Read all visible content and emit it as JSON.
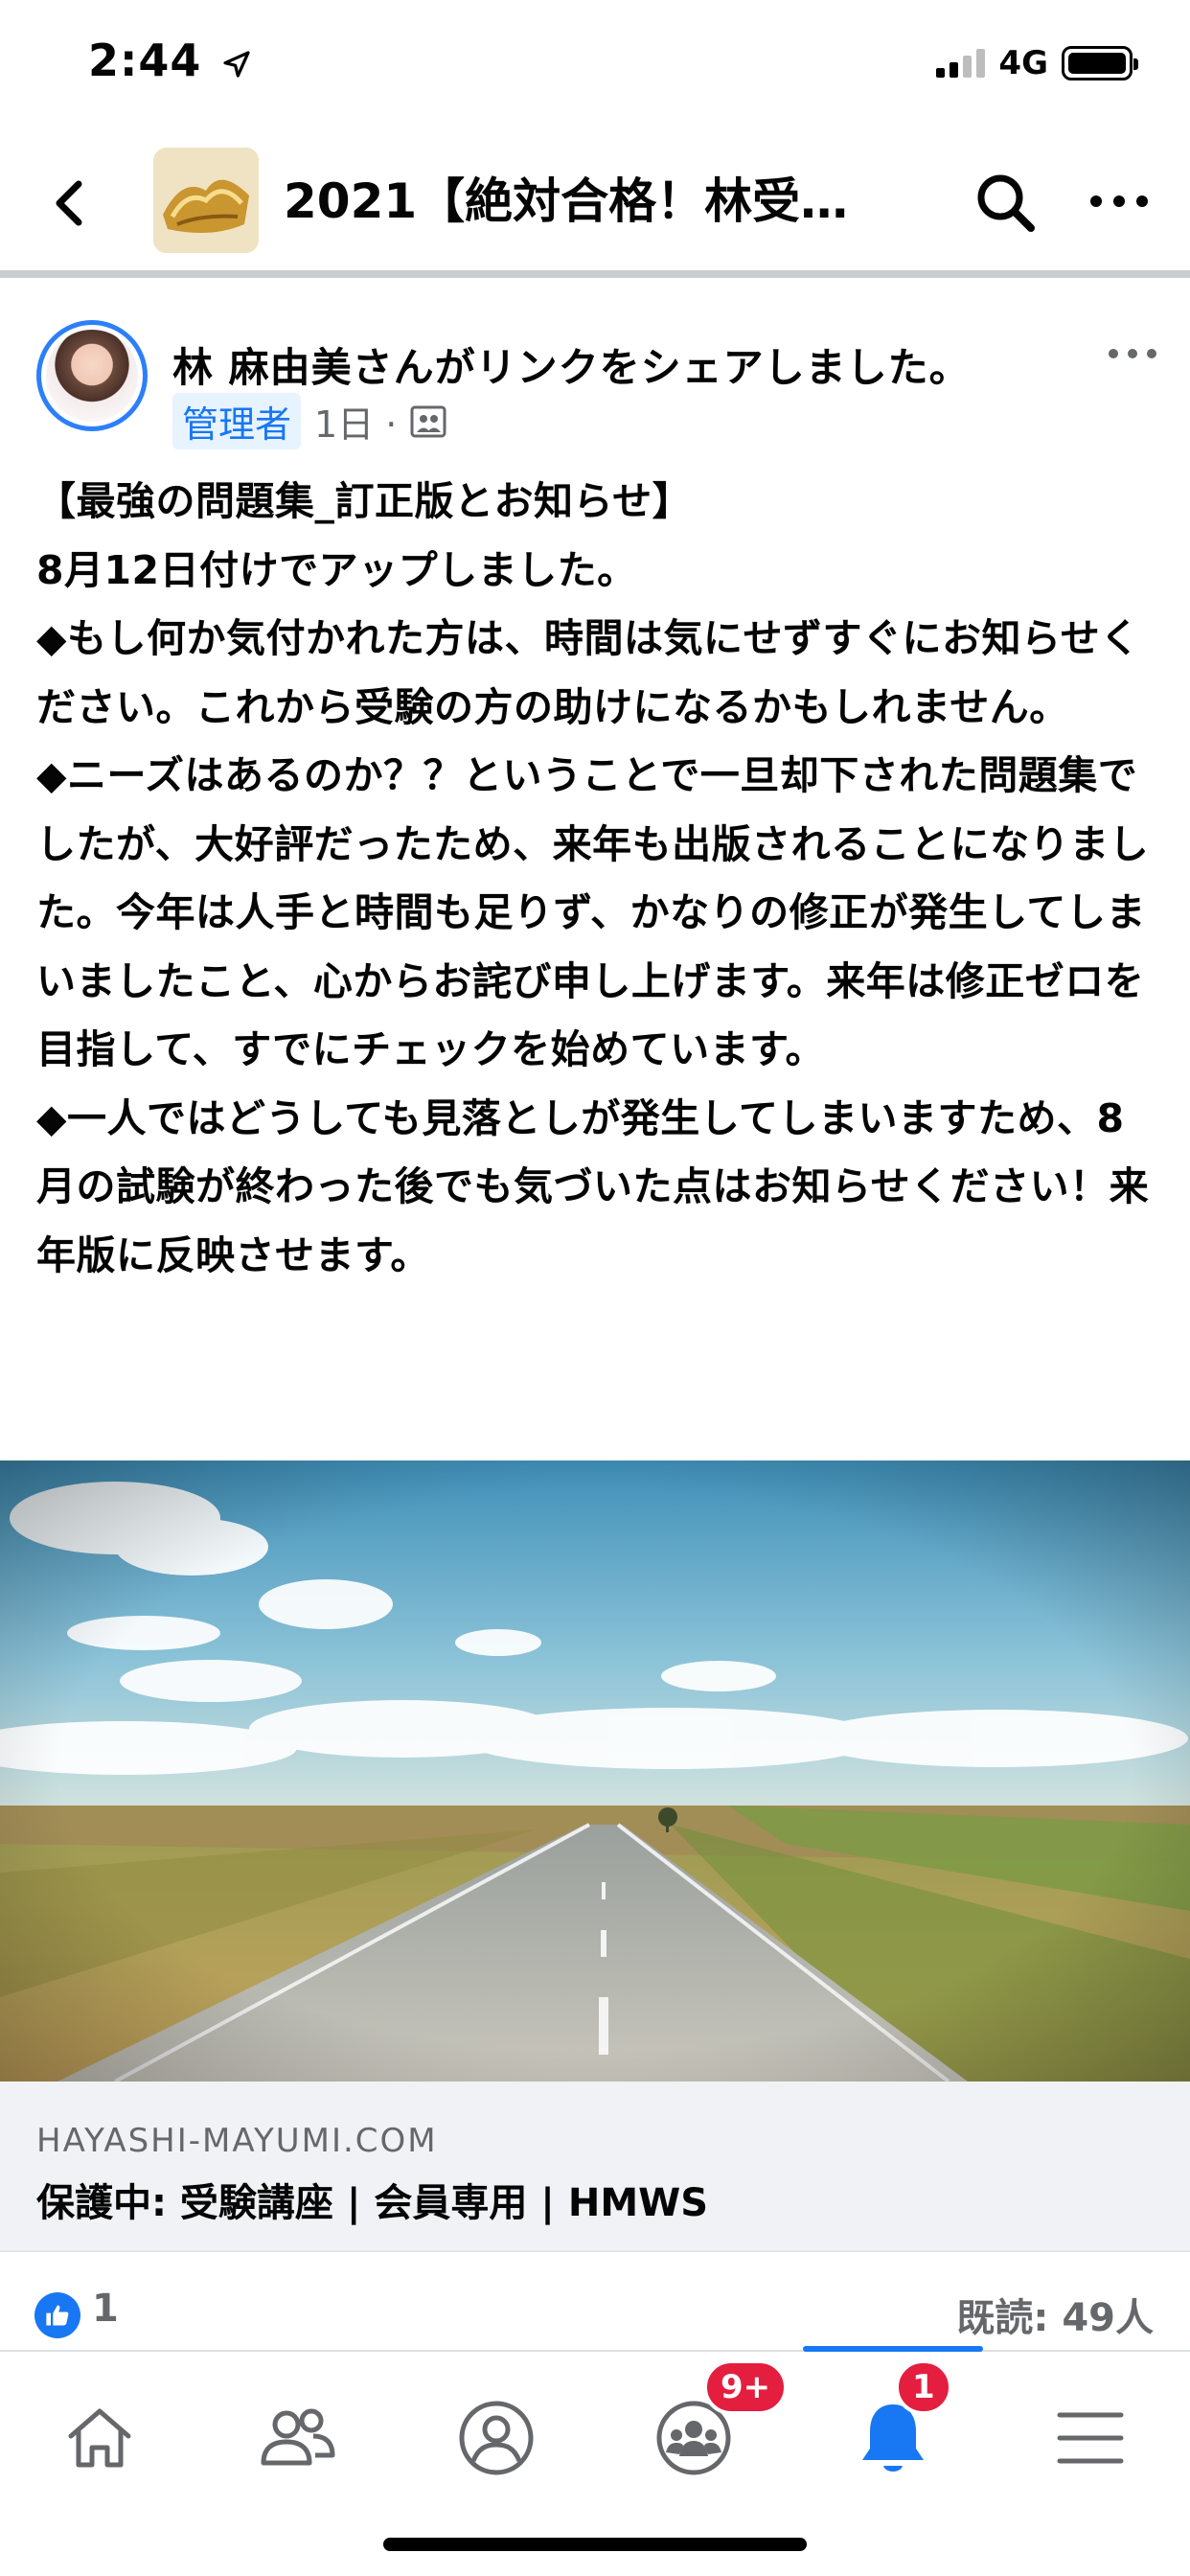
{
  "status_bar": {
    "time": "2:44",
    "network": "4G",
    "icons": [
      "location-arrow-icon",
      "signal-icon",
      "battery-icon"
    ]
  },
  "header": {
    "title": "2021【絶対合格！林受験…",
    "icons": [
      "back-icon",
      "search-icon",
      "more-icon"
    ]
  },
  "post": {
    "author_line": "林 麻由美さんがリンクをシェアしました。",
    "role_badge": "管理者",
    "time": "1日 ·",
    "privacy_icon": "group-icon",
    "paragraphs": [
      "【最強の問題集_訂正版とお知らせ】",
      "8月12日付けでアップしました。",
      "◆もし何か気付かれた方は、時間は気にせずすぐにお知らせください。これから受験の方の助けになるかもしれません。",
      "◆ニーズはあるのか？？ということで一旦却下された問題集でしたが、大好評だったため、来年も出版されることになりました。今年は人手と時間も足りず、かなりの修正が発生してしまいましたこと、心からお詫び申し上げます。来年は修正ゼロを目指して、すでにチェックを始めています。",
      "◆一人ではどうしても見落としが発生してしまいますため、8月の試験が終わった後でも気づいた点はお知らせください！来年版に反映させます。"
    ]
  },
  "link_preview": {
    "domain": "HAYASHI-MAYUMI.COM",
    "title": "保護中: 受験講座 | 会員専用 | HMWS"
  },
  "reactions": {
    "like_count": "1",
    "seen": "既読: 49人"
  },
  "bottom_nav": {
    "items": [
      "home-icon",
      "friends-icon",
      "profile-icon",
      "groups-icon",
      "notifications-icon",
      "menu-icon"
    ],
    "groups_badge": "9+",
    "notifications_badge": "1",
    "active": "notifications",
    "accent": "#1877f2",
    "badge_color": "#e41e3f"
  }
}
